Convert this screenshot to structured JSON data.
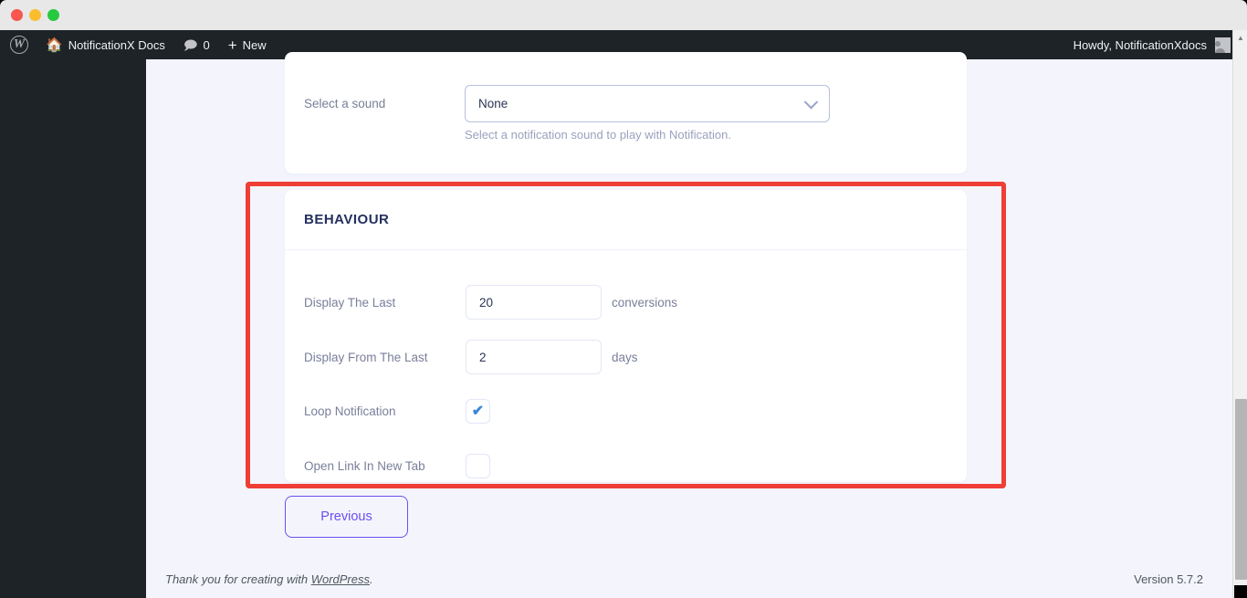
{
  "window": {
    "traffic_lights": [
      "close",
      "minimize",
      "maximize"
    ]
  },
  "adminbar": {
    "wp_logo": "W",
    "site_name": "NotificationX Docs",
    "comments_count": "0",
    "new_label": "New",
    "howdy": "Howdy, NotificationXdocs"
  },
  "sound_section": {
    "label": "Select a sound",
    "selected_value": "None",
    "help_text": "Select a notification sound to play with Notification."
  },
  "behaviour": {
    "title": "BEHAVIOUR",
    "rows": [
      {
        "label": "Display The Last",
        "value": "20",
        "unit": "conversions"
      },
      {
        "label": "Display From The Last",
        "value": "2",
        "unit": "days"
      }
    ],
    "checkboxes": [
      {
        "label": "Loop Notification",
        "checked": true,
        "mark": "✔"
      },
      {
        "label": "Open Link In New Tab",
        "checked": false,
        "mark": ""
      }
    ]
  },
  "nav": {
    "previous_label": "Previous"
  },
  "footer": {
    "thanks_prefix": "Thank you for creating with ",
    "wordpress_link": "WordPress",
    "thanks_suffix": ".",
    "version": "Version 5.7.2"
  },
  "colors": {
    "accent_purple": "#6c4ef0",
    "highlight_red": "#ef3e36",
    "adminbar_dark": "#1d2327",
    "page_bg": "#f4f5fc",
    "heading_navy": "#24305e",
    "check_blue": "#3d85d8"
  }
}
